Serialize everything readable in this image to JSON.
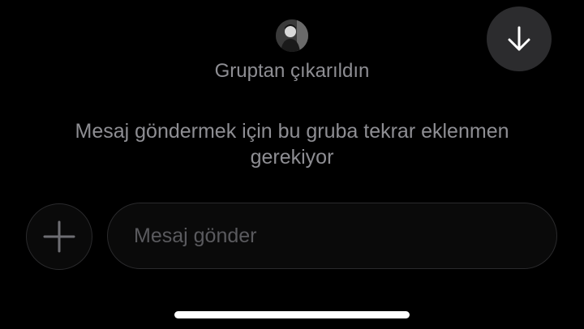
{
  "group": {
    "removed_notice": "Gruptan çıkarıldın",
    "readd_info": "Mesaj göndermek için bu gruba tekrar eklenmen gerekiyor"
  },
  "composer": {
    "placeholder": "Mesaj gönder",
    "add_icon": "plus-icon"
  },
  "scroll_button": {
    "icon": "arrow-down-icon"
  },
  "colors": {
    "background": "#000000",
    "text_secondary": "#8e8e93",
    "button_bg": "#2c2c2e",
    "home_indicator": "#ffffff"
  }
}
